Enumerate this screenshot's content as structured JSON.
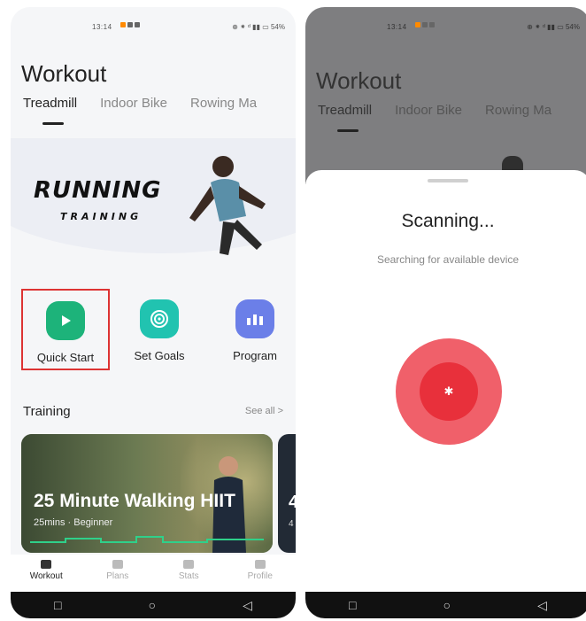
{
  "left": {
    "status": {
      "time": "13:14",
      "system": "⊕ ⁕ ᵈ ▮▮ ▭ 54%"
    },
    "title": "Workout",
    "tabs": [
      "Treadmill",
      "Indoor Bike",
      "Rowing Ma"
    ],
    "banner": {
      "headline": "RUNNING",
      "subheadline": "TRAINING"
    },
    "actions": [
      {
        "label": "Quick Start",
        "icon": "play-icon"
      },
      {
        "label": "Set Goals",
        "icon": "target-icon"
      },
      {
        "label": "Program",
        "icon": "chart-icon"
      }
    ],
    "training": {
      "heading": "Training",
      "see_all": "See all >",
      "card": {
        "title": "25 Minute Walking HIIT",
        "meta": "25mins · Beginner"
      },
      "card2": {
        "title": "4",
        "meta": "4"
      }
    },
    "bottom_nav": [
      "Workout",
      "Plans",
      "Stats",
      "Profile"
    ],
    "system_nav": [
      "□",
      "○",
      "◁"
    ]
  },
  "right": {
    "status": {
      "time": "13:14",
      "system": "⊕ ⁕ ᵈ ▮▮ ▭ 54%"
    },
    "title": "Workout",
    "tabs": [
      "Treadmill",
      "Indoor Bike",
      "Rowing Ma"
    ],
    "sheet": {
      "title": "Scanning...",
      "subtitle": "Searching for available device",
      "icon": "bluetooth-icon",
      "icon_glyph": "✱"
    },
    "system_nav": [
      "□",
      "○",
      "◁"
    ]
  },
  "colors": {
    "quick_start_green": "#1db37a",
    "goals_teal": "#21c3b0",
    "program_blue": "#6b7fe8",
    "scan_red": "#e8303b",
    "highlight_border": "#dd3333"
  }
}
